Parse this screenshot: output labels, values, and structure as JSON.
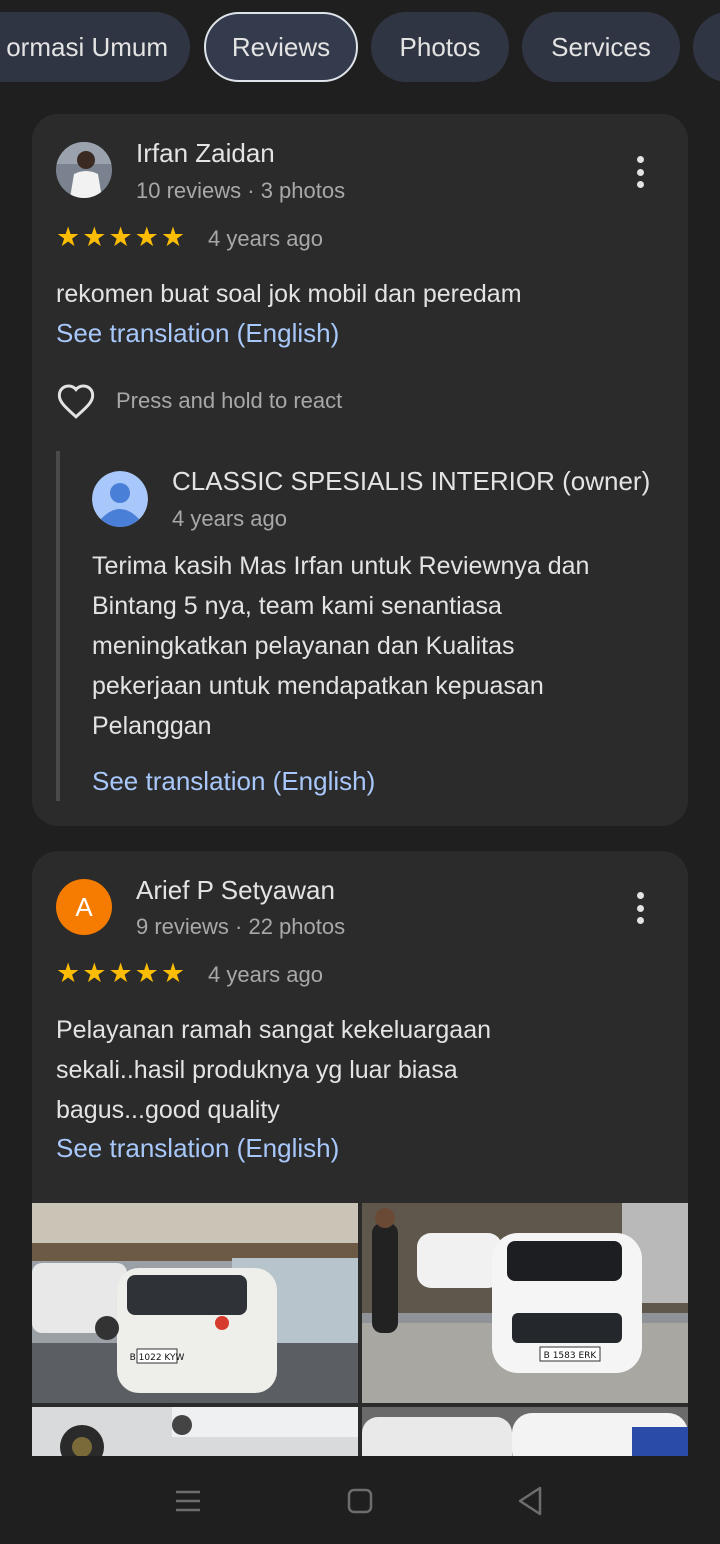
{
  "tabs": [
    {
      "label": "ormasi Umum"
    },
    {
      "label": "Reviews",
      "active": true
    },
    {
      "label": "Photos"
    },
    {
      "label": "Services"
    }
  ],
  "reviews": [
    {
      "name": "Irfan Zaidan",
      "meta": "10 reviews · 3 photos",
      "rating": 5,
      "time": "4 years ago",
      "text": "rekomen buat soal jok mobil dan peredam",
      "translate": "See translation (English)",
      "react_hint": "Press and hold to react",
      "owner_reply": {
        "name": "CLASSIC SPESIALIS INTERIOR (owner)",
        "time": "4 years ago",
        "lines": [
          "Terima kasih Mas Irfan untuk Reviewnya dan",
          "Bintang 5 nya, team kami senantiasa",
          "meningkatkan pelayanan dan Kualitas",
          "pekerjaan untuk mendapatkan kepuasan",
          "Pelanggan"
        ],
        "translate": "See translation (English)"
      }
    },
    {
      "name": "Arief P Setyawan",
      "avatar_letter": "A",
      "meta": "9 reviews · 22 photos",
      "rating": 5,
      "time": "4 years ago",
      "lines": [
        "Pelayanan ramah sangat kekeluargaan",
        "sekali..hasil produknya yg luar biasa",
        "bagus...good quality"
      ],
      "translate": "See translation (English)"
    }
  ],
  "plates": [
    "B 1022 KYW",
    "B 1583 ERK"
  ],
  "colors": {
    "accent_link": "#a8c7fa",
    "star": "#fbbc04",
    "avatar_orange": "#f57c00"
  }
}
